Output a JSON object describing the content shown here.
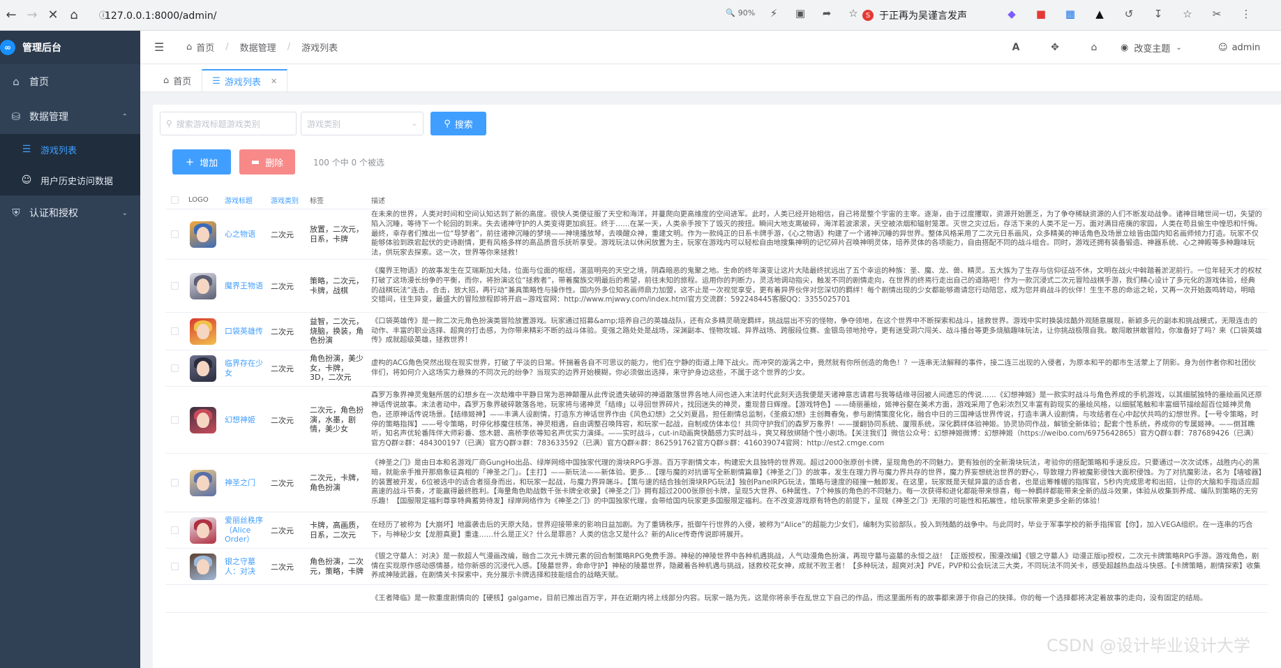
{
  "browser": {
    "url": "127.0.0.1:8000/admin/",
    "zoom": "90%",
    "news_text": "于正再为吴谨言发声"
  },
  "sidebar": {
    "app_title": "管理后台",
    "items": [
      {
        "label": "首页"
      },
      {
        "label": "数据管理"
      },
      {
        "label": "游戏列表"
      },
      {
        "label": "用户历史访问数据"
      },
      {
        "label": "认证和授权"
      }
    ]
  },
  "header": {
    "breadcrumb": [
      "首页",
      "数据管理",
      "游戏列表"
    ],
    "theme_label": "改变主题",
    "user": "admin"
  },
  "tabs": [
    {
      "label": "首页"
    },
    {
      "label": "游戏列表"
    }
  ],
  "search": {
    "keyword_placeholder": "搜索游戏标题游戏类别",
    "category_placeholder": "游戏类别",
    "search_button": "搜索"
  },
  "actions": {
    "add": "增加",
    "delete": "删除",
    "selection_info": "100 个中 0 个被选"
  },
  "table": {
    "headers": [
      "LOGO",
      "游戏标题",
      "游戏类别",
      "标签",
      "描述"
    ],
    "rows": [
      {
        "title": "心之物语",
        "category": "二次元",
        "tags": "放置，二次元，日系，卡牌",
        "logo_colors": [
          "#f4a93c",
          "#3a6ab7"
        ],
        "description": "在未来的世界，人类对时间和空间认知达到了新的高度。很快人类便征服了天空和海洋，并蔓爬向更高维度的空间进军。此时，人类已经开始相信，自己将是整个宇宙的主宰。逐渐，由于过度攫取，资源开始匮乏，为了争夺稀缺资源的人们不断发动战争。诸神目睹世间一切，失望的陷入沉睡，等待下一个轮回的到来。失去诸神守护的人类变得更加疯狂。终于……在某一天，人类亲手按下了毁灭的按扭。瞬间大地支离破碎，海洋若波滚滚，天空被浓烟和辐射笼罩。灭世之灾过后，存活下来的人类不足一万。面对满目疮痍的家园，人类在苟且偷生中惶恐和忏悔。最终，幸存者们推出一位“导梦者”，前往诸神沉睡的梦境——神境播放琴，去唤醒众神，重建文明。作为一款纯正的日系卡牌手游，《心之物语》构建了一个诸神沉睡的异世界。整体风格采用了二次元日系画风，众多精美的神话角色及场景立绘皆由国内知名画师倾力打造。玩家不仅能够体验到跌宕起伏的史诗剧情，更有风格多样的高品质音乐抚听享受。游戏玩法以休闲放置为主，玩家在游戏内可以轻松自由地搜集神明的记忆碎片召唤神明灵体，培养灵体的各项能力，自由搭配不同的战斗组合。同时，游戏还拥有装备锻造、神器系统、心之神殿等多种趣味玩法，供玩家去探索。这一次，世界等你来拯救！"
      },
      {
        "title": "魔界王物语",
        "category": "二次元",
        "tags": "策略，二次元，卡牌，战棋",
        "logo_colors": [
          "#d9d9e3",
          "#5b5f73"
        ],
        "description": "《魔界王物语》的故事发生在艾瑞斯加大陆，位面与位面的枢纽，湛蓝明亮的天空之境，阴森暗恶的鬼聚之地。生命的终年演变让这片大陆最终扰远出了五个幸运的种族：圣、魔、龙、兽、精灵。五大族为了生存与信仰征战不休，文明在战火中斡踏着淤泥前行。一位年轻天才的权杖打破了这场漫长纷争的平衡，而你，将扮演这位“拯救者”，带着魔族交明最后的希望，前往未知的旅程。运用你的判断力，灵活地调动指尖，触发不同的剧情走向，在世界的终焉行走出自己的道路吧！作为一款沉浸式二次元冒险战棋手游，我们精心设计了多元化的游戏体验，经典的战棋玩法“连击，合击，放大招，再行动”兼具策略性与操作性。国内外多位知名画师鼎力加盟，这不止是一次视觉享受，更有着异界伙伴对您深切的羁绊！每个剧情出现的少女都能够邀请您行动陪您，成为您并肩战斗的伙伴！生生不息的命运之轮，又再一次开始轰鸣转动，明暗交错间，往生异变，最盛大的冒险旅程即将开启~游戏官网：http://www.mjwwy.com/index.html官方交流群：592248445客服QQ：3355025701"
      },
      {
        "title": "口袋英雄传",
        "category": "二次元",
        "tags": "益智，二次元，烧脑，换装，角色扮演",
        "logo_colors": [
          "#d73a2f",
          "#f2c14e"
        ],
        "description": "《口袋英雄传》是一款二次元角色扮演类冒险放置游戏。玩家通过招募&amp;培养自己的英雄战队，还有众多精灵萌宠羁绊，挑战层出不穷的怪物，争夺领地，在这个世界中不断探索和战斗，拯救世界。游戏中实时换装炫酷外观随意展现，新颖多元的副本和挑战模式，无限连击的动作、丰富的职业选择、超爽的打击感，为你带来精彩不断的战斗体验。变强之路处处是战场，深渊副本、怪物攻城、异界战场、跨服段位赛、金银岛领地抢夺，更有迷受洞穴闯关、战斗播台等更多烧脑趣味玩法，让你挑战极限自我。敢闯敢拼敢冒险，你准备好了吗？来《口袋英雄传》成就超级英雄，拯救世界！"
      },
      {
        "title": "临界存在少女",
        "category": "二次元",
        "tags": "角色扮演，美少女，卡牌，3D，二次元",
        "logo_colors": [
          "#6b6e8a",
          "#2a2d3e"
        ],
        "description": "虚构的ACG角色突然出现在现实世界，打破了平淡的日常。怀揣着各自不可思议的能力，他们在宁静的街道上降下战火。而冲突的漩涡之中，竟然就有你所创造的角色！？一连串无法解释的事件，接二连三出现的入侵者，为原本和平的都市生活蒙上了阴影。身为创作者你和社团伙伴们，将如何介入这场实力悬殊的不同次元的纷争？当现实的边界开始模糊，你必须做出选择，来守护身边这些，不属于这个世界的少女。"
      },
      {
        "title": "幻想神姬",
        "category": "二次元",
        "tags": "二次元，角色扮演，水墨，剧情，美少女",
        "logo_colors": [
          "#3a3040",
          "#c94b5a"
        ],
        "description": "森罗万象界神灵鬼魅所居的幻想乡在一次劫难中平静日常为恶神颠覆从此传说遗失破碎的神道散落世界各地人间也进入末法时代此刻天选我便是天诸神意志请君与我等结缘寻回被人间遗忘的传说……《幻想神姬》是一款实时战斗与角色养成的手机游戏，以其细腻独特的墨绘画风还原神话传说故事。末法者动中，森罗万象界破碎散落各地，玩家将与诸神灵「结缘」以寻回世界碎片，找回迷失的神灵，重现昔日辉煌。【游戏特色】——绮丽墨绘，姬神谷壑在美术方面，游戏采用了色彩浓烈又丰富有韵现实的墨绘风格，以细腻笔触和丰富细节描绘超百位姬神灵角色，还原神话传说场景。【结缘姬神】——丰满人设剧情，打造东方神话世界作由《风色幻想》之父刘夏昌，担任剧情总监制，《圣痕幻想》主创舞春兔，参与剧情策度化化，融合中日的三国神话世界传说，打造丰满人设剧情，与攻结者在心中起伏共鸣的幻想世界。【一号令策略，时停的策略指挥】——号令策略，时停化移魔住核荡，神灵相遇，自由调整召唤阵容，和玩家一起战，自制成仿体本位！共同守护我们的森罗万象界！——援翻协同系统、厦限系统，深化羁绊体验神姬。协灵协同作战，解锁全新体验；配套个性系统，养成你的专属姬神。——倒耳瞧听，知名声优轮番阵伴大师彩番、悠木碧、高桥李依等知名声优实力演绎。——实时战斗，cut-in动画爽快酷感力实时战斗，爽又释放绑随个性小剧场。【关注我们】微信公众号：幻想神姬微博：幻想神姬（https://weibo.com/6975642865）官方Q群①群：787689426（已满）官方Q群②群：484300197（已满）官方Q群③群：783633592（已满）官方Q群④群：862591762官方Q群⑤群：416039074官网：http://est2.cmge.com"
      },
      {
        "title": "神圣之门",
        "category": "二次元",
        "tags": "二次元，卡牌，角色扮演",
        "logo_colors": [
          "#e9c98a",
          "#5a6fa8"
        ],
        "description": "《神圣之门》是由日本和名游戏厂商GungHo出品、绿岸网络中国独家代理的滑块RPG手游。百万字剧情文本，构建宏大且独特的世界观。超过2000张原创卡牌，呈现角色的不同魅力。更有独创的全新滑块玩法，考验你的搭配策略和手速反应。只要通过一次次试炼，战胜内心的黑暗，就能亲手推开那扇象征真相的「神圣之门」。【主打】——新玩法——新体验。更多…【理与魔的对抗谱写全新剧情篇章】《神圣之门》的故事，发生在理力界与魔力界共存的世界，魔力界妄想统治世界的野心，导致理力界被魔影侵蚀大面积侵蚀。为了对抗魔影法，名为【墙嘘器】的装置被开发，6位被选中的适合者挺身而出，和玩家一起战，与魔力界异端斗。【策与速的结合独创滑块RPG玩法】独创PanelRPG玩法，策略与速度的碰撞一触即发。在这里，玩家既是天赋异禀的适合者，也是运筹帷幄的指挥官，5秒内完成思考和出招，让你的大脑和手指适应超高速的战斗节奏，才能赢得最终胜利。【海量角色助战数千张卡牌全收录】《神圣之门》拥有超过2000张原创卡牌，呈现5大世界、6种属性、7个种族的角色的不同魅力。每一次获得和进化都能带来惊喜，每一种羁绊都能带来全新的战斗效果，体验从收集到养成、编队到策略的无穷乐趣！【国服限定福利尊享特典蓄势待发】绿岸网络作为《神圣之门》的中国独家代理，会带给国内玩家更多国服限定福利。在不改变游戏原有特色的前提下，呈现《神圣之门》无限的可能性和拓展性，给玩家带来更多全新的体验！"
      },
      {
        "title": "爱丽丝秩序（Alice Order）",
        "category": "二次元",
        "tags": "卡牌，高画质，日系，二次元",
        "logo_colors": [
          "#e6e6ee",
          "#b03040"
        ],
        "description": "在经历了被称为【大崩坏】地震袭击后的天原大陆，世界迎接带来的影响日益加剧。为了重铸秩序，抵御午行世界的入侵，被称为“Alice”的超能力少女们，编制为实验部队，投入到残酷的战争中。与此同时，毕业于军事学校的新手指挥官【你】，加入VEGA组织。在一连串的巧合下，与神秘少女【龙胆真夏】重逢……什么是正义？什么是罪恶？人类的信念又是什么？新的Alice传奇传说即将展开。"
      },
      {
        "title": "银之守墓人：对决",
        "category": "二次元",
        "tags": "角色扮演，二次元，策略，卡牌",
        "logo_colors": [
          "#5a4030",
          "#9db8d9"
        ],
        "description": "《银之守墓人：对决》是一款超人气漫画改编，融合二次元卡牌元素的回合制策略RPG免费手游。神秘的神陵世界中各种机遇挑战，人气动漫角色扮演，再现守墓与盗墓的永恒之战！【正版授权，围漫改编】《银之守墓人》动漫正版ip授权，二次元卡牌策略RPG手游。游戏角色，剧情在实现原作感动感情基，给你新感的沉浸代入感。【陵墓世界，命命守护】神秘的陵墓世界，隐藏着各种机遇与挑战，拯救校花女神，成就不败王者！【多种玩法，超爽对决】PVE，PVP和公会玩法三大类，不同玩法不同关卡，感受超越热血战斗快感。【卡牌策略，剧情探索】收集养成神陵武器，在剧情关卡探索中，充分展示卡牌选择和技能组合的战略天赋。"
      },
      {
        "title": "",
        "category": "",
        "tags": "",
        "logo_colors": [
          "#ffffff",
          "#ffffff"
        ],
        "description": "《王者降临》是一款重度剧情向的【硬核】galgame，目前已推出百万字，并在近期内将上线部分内容。玩家一路为先，这是你将亲手在乱世立下自己的作品，而这里面所有的故事都来源于你自己的抉择。你的每一个选择都将决定着故事的走向，没有固定的结局。"
      }
    ]
  },
  "watermark": "CSDN @设计毕业设计大学"
}
